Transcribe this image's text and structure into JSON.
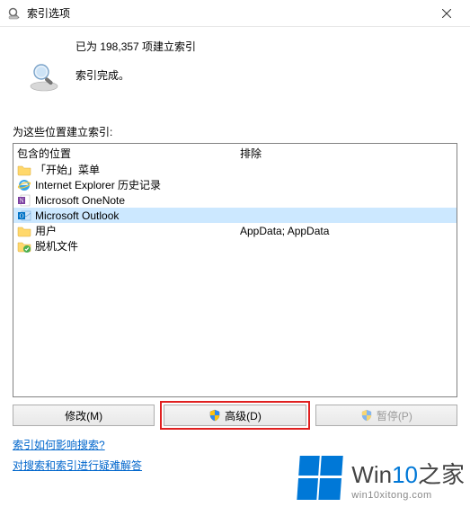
{
  "titlebar": {
    "title": "索引选项"
  },
  "status": {
    "count_line": "已为 198,357 项建立索引",
    "complete_line": "索引完成。"
  },
  "section_label": "为这些位置建立索引:",
  "columns": {
    "included": "包含的位置",
    "excluded": "排除"
  },
  "rows": [
    {
      "icon": "folder",
      "label": "「开始」菜单",
      "exclude": ""
    },
    {
      "icon": "ie",
      "label": "Internet Explorer 历史记录",
      "exclude": ""
    },
    {
      "icon": "onenote",
      "label": "Microsoft OneNote",
      "exclude": ""
    },
    {
      "icon": "outlook",
      "label": "Microsoft Outlook",
      "exclude": "",
      "selected": true
    },
    {
      "icon": "folder",
      "label": "用户",
      "exclude": "AppData; AppData"
    },
    {
      "icon": "offline",
      "label": "脱机文件",
      "exclude": ""
    }
  ],
  "buttons": {
    "modify": "修改(M)",
    "advanced": "高级(D)",
    "pause": "暂停(P)"
  },
  "links": {
    "link1": "索引如何影响搜索?",
    "link2": "对搜索和索引进行疑难解答"
  },
  "watermark": {
    "brand_prefix": "Win",
    "brand_num": "10",
    "brand_suffix": "之家",
    "url": "win10xitong.com"
  }
}
